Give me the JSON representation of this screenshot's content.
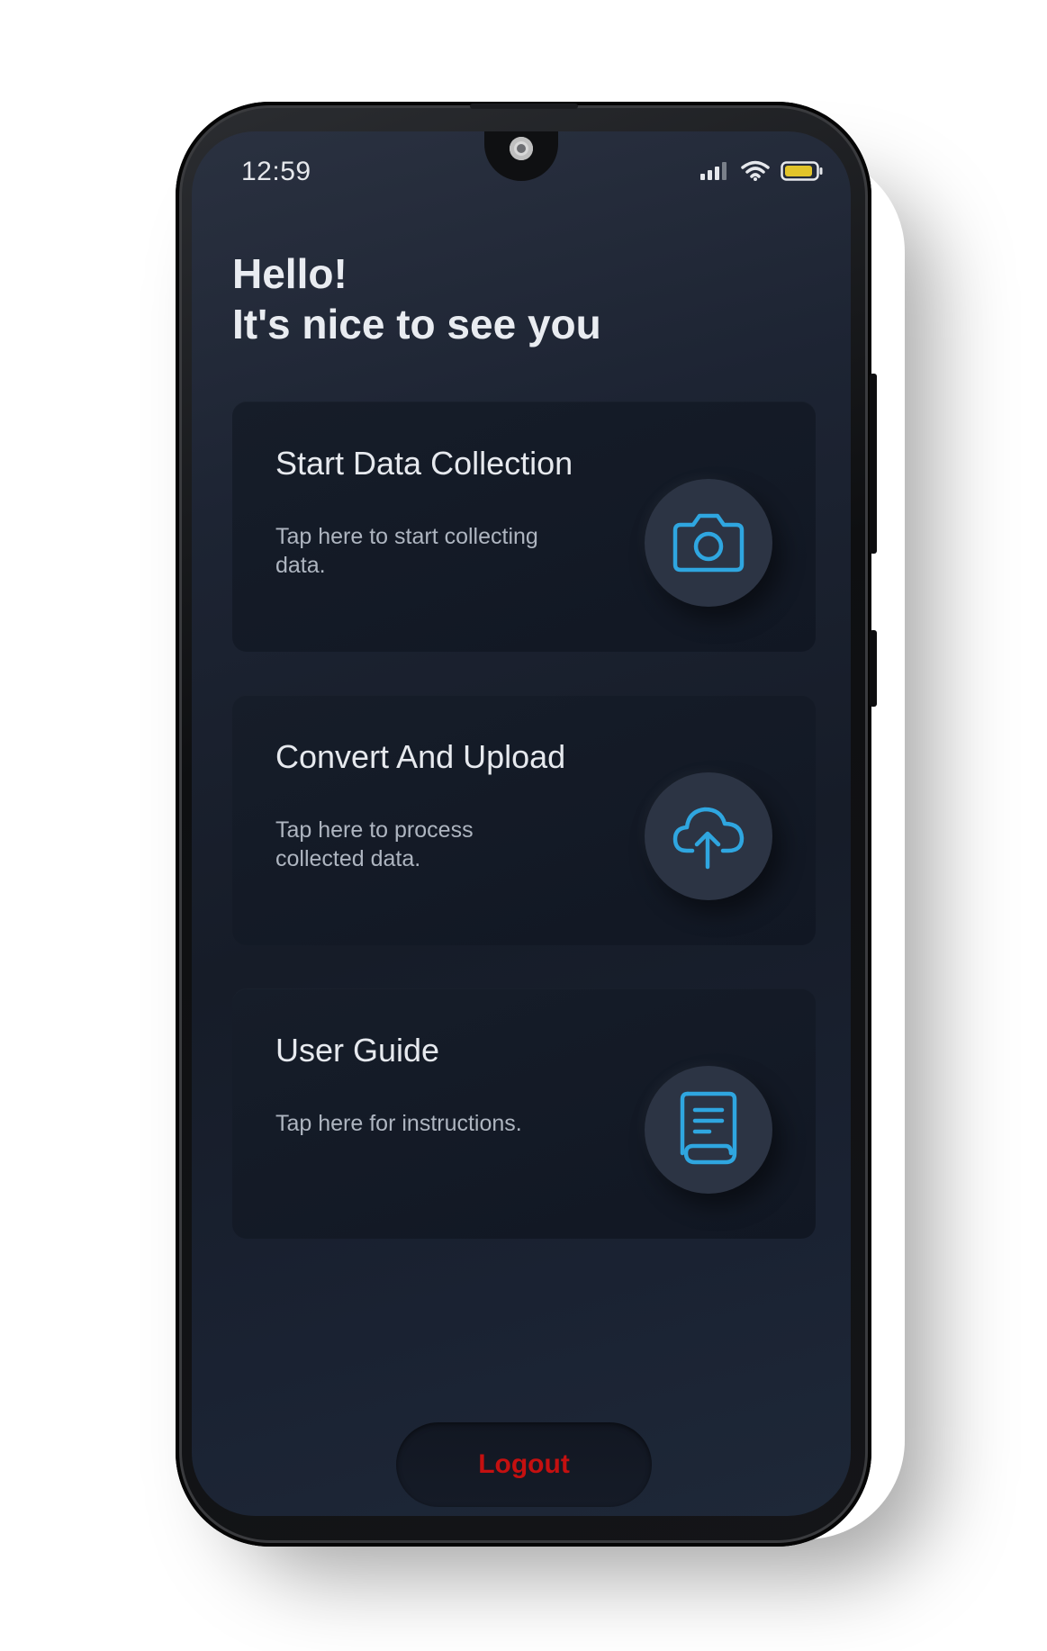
{
  "status_bar": {
    "time": "12:59",
    "battery_color": "#e2c42a"
  },
  "greeting": {
    "line1": "Hello!",
    "line2": "It's nice to see you"
  },
  "cards": [
    {
      "title": "Start Data Collection",
      "subtitle": "Tap here to start collecting data.",
      "icon": "camera-icon"
    },
    {
      "title": "Convert And Upload",
      "subtitle": "Tap here to process collected data.",
      "icon": "cloud-upload-icon"
    },
    {
      "title": "User Guide",
      "subtitle": "Tap here for instructions.",
      "icon": "document-icon"
    }
  ],
  "logout": {
    "label": "Logout",
    "color": "#c41010"
  },
  "colors": {
    "accent_icon": "#2fa6e0",
    "background": "#1a2130",
    "card": "#131a26"
  }
}
